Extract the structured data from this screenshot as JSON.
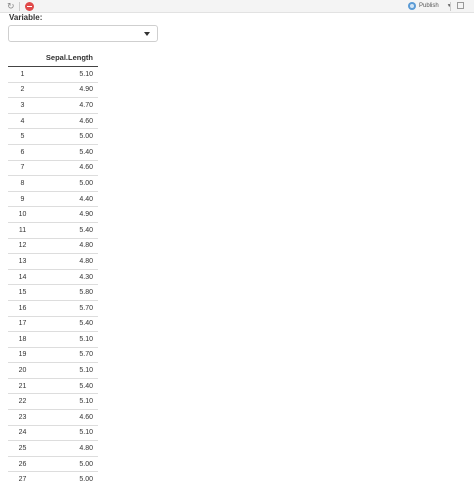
{
  "toolbar": {
    "refresh_icon": "refresh-icon",
    "stop_icon": "stop-icon",
    "publish_label": "Publish",
    "popout_icon": "popout-icon"
  },
  "variable": {
    "label": "Variable:",
    "selected": ""
  },
  "table": {
    "columns": [
      "",
      "Sepal.Length"
    ],
    "rows": [
      {
        "index": "1",
        "value": "5.10"
      },
      {
        "index": "2",
        "value": "4.90"
      },
      {
        "index": "3",
        "value": "4.70"
      },
      {
        "index": "4",
        "value": "4.60"
      },
      {
        "index": "5",
        "value": "5.00"
      },
      {
        "index": "6",
        "value": "5.40"
      },
      {
        "index": "7",
        "value": "4.60"
      },
      {
        "index": "8",
        "value": "5.00"
      },
      {
        "index": "9",
        "value": "4.40"
      },
      {
        "index": "10",
        "value": "4.90"
      },
      {
        "index": "11",
        "value": "5.40"
      },
      {
        "index": "12",
        "value": "4.80"
      },
      {
        "index": "13",
        "value": "4.80"
      },
      {
        "index": "14",
        "value": "4.30"
      },
      {
        "index": "15",
        "value": "5.80"
      },
      {
        "index": "16",
        "value": "5.70"
      },
      {
        "index": "17",
        "value": "5.40"
      },
      {
        "index": "18",
        "value": "5.10"
      },
      {
        "index": "19",
        "value": "5.70"
      },
      {
        "index": "20",
        "value": "5.10"
      },
      {
        "index": "21",
        "value": "5.40"
      },
      {
        "index": "22",
        "value": "5.10"
      },
      {
        "index": "23",
        "value": "4.60"
      },
      {
        "index": "24",
        "value": "5.10"
      },
      {
        "index": "25",
        "value": "4.80"
      },
      {
        "index": "26",
        "value": "5.00"
      },
      {
        "index": "27",
        "value": "5.00"
      }
    ]
  }
}
